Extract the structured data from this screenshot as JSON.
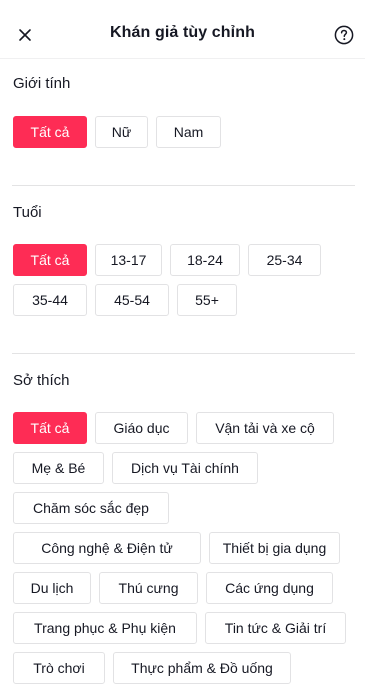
{
  "header": {
    "title": "Khán giả tùy chỉnh",
    "close_icon": "close-icon",
    "help_icon": "question-circle-icon"
  },
  "colors": {
    "accent": "#fe2c55",
    "chip_border": "#e2e2e4",
    "text": "#161823",
    "divider": "#e3e3e4"
  },
  "gender": {
    "title": "Giới tính",
    "options": [
      {
        "label": "Tất cả",
        "selected": true
      },
      {
        "label": "Nữ",
        "selected": false
      },
      {
        "label": "Nam",
        "selected": false
      }
    ]
  },
  "age": {
    "title": "Tuổi",
    "options": [
      {
        "label": "Tất cả",
        "selected": true
      },
      {
        "label": "13-17",
        "selected": false
      },
      {
        "label": "18-24",
        "selected": false
      },
      {
        "label": "25-34",
        "selected": false
      },
      {
        "label": "35-44",
        "selected": false
      },
      {
        "label": "45-54",
        "selected": false
      },
      {
        "label": "55+",
        "selected": false
      }
    ]
  },
  "interests": {
    "title": "Sở thích",
    "options": [
      {
        "label": "Tất cả",
        "selected": true
      },
      {
        "label": "Giáo dục",
        "selected": false
      },
      {
        "label": "Vận tải và xe cộ",
        "selected": false
      },
      {
        "label": "Mẹ & Bé",
        "selected": false
      },
      {
        "label": "Dịch vụ Tài chính",
        "selected": false
      },
      {
        "label": "Chăm sóc sắc đẹp",
        "selected": false
      },
      {
        "label": "Công nghệ & Điện tử",
        "selected": false
      },
      {
        "label": "Thiết bị gia dụng",
        "selected": false
      },
      {
        "label": "Du lịch",
        "selected": false
      },
      {
        "label": "Thú cưng",
        "selected": false
      },
      {
        "label": "Các ứng dụng",
        "selected": false
      },
      {
        "label": "Trang phục & Phụ kiện",
        "selected": false
      },
      {
        "label": "Tin tức & Giải trí",
        "selected": false
      },
      {
        "label": "Trò chơi",
        "selected": false
      },
      {
        "label": "Thực phẩm & Đồ uống",
        "selected": false
      }
    ]
  }
}
